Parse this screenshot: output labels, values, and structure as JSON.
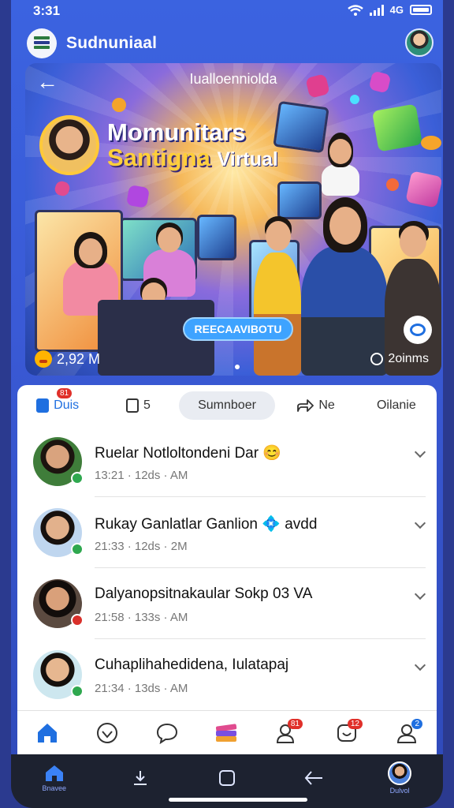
{
  "status": {
    "time": "3:31",
    "network": "4G"
  },
  "app": {
    "title": "Sudnuniaal"
  },
  "hero": {
    "caption": "Iualloenniolda",
    "title_line1": "Momunitars",
    "title_line2": "Santigna",
    "title_line2_suffix": "Virtual",
    "button_label": "REECAAVIBOTU",
    "reactions": "2,92 M",
    "duration": "2oinms"
  },
  "tabs": [
    {
      "label": "Duis",
      "badge": "81",
      "icon": "video-icon"
    },
    {
      "label": "5",
      "icon": "media-icon"
    },
    {
      "label": "Sumnboer",
      "active": true
    },
    {
      "label": "Ne",
      "icon": "share-icon"
    },
    {
      "label": "Oilanie"
    }
  ],
  "list": [
    {
      "name": "Ruelar Notloltondeni Dar",
      "emoji": "😊",
      "meta": "13:21 · 12ds · AM",
      "status_color": "#2fa84f",
      "avatar_bg": "#3f7d3a",
      "skin": "#d9a37e",
      "hair": "#1c140f",
      "shirt": "#e9627a"
    },
    {
      "name": "Rukay Ganlatlar Ganlion",
      "emoji": "💠",
      "suffix": "avdd",
      "meta": "21:33 · 12ds · 2M",
      "status_color": "#2fa84f",
      "avatar_bg": "#bfd6ef",
      "skin": "#e2b18c",
      "hair": "#17110e",
      "shirt": "#8ab0dc"
    },
    {
      "name": "Dalyanopsitnakaular Sokp 03 VA",
      "meta": "21:58 · 133s · AM",
      "status_color": "#d9302a",
      "avatar_bg": "#5b4a40",
      "skin": "#d9a07a",
      "hair": "#120d0b",
      "shirt": "#1b1b1b"
    },
    {
      "name": "Cuhaplihahedidena, Iulatapaj",
      "meta": "21:34 · 13ds · AM",
      "status_color": "#2fa84f",
      "avatar_bg": "#cde7ef",
      "skin": "#e6b790",
      "hair": "#15100d",
      "shirt": "#e27aa8"
    }
  ],
  "appnav": [
    {
      "name": "home",
      "badge": ""
    },
    {
      "name": "heart",
      "badge": ""
    },
    {
      "name": "chat",
      "badge": ""
    },
    {
      "name": "stack",
      "badge": ""
    },
    {
      "name": "friends",
      "badge": "81"
    },
    {
      "name": "notifications",
      "badge": "12"
    },
    {
      "name": "profile",
      "badge": "2"
    }
  ],
  "sysnav": {
    "home_label": "Bnavee",
    "profile_label": "Dulvol"
  },
  "colors": {
    "accent": "#1f6fe0",
    "badge": "#e0302a",
    "nav_bg": "#1d2230"
  }
}
